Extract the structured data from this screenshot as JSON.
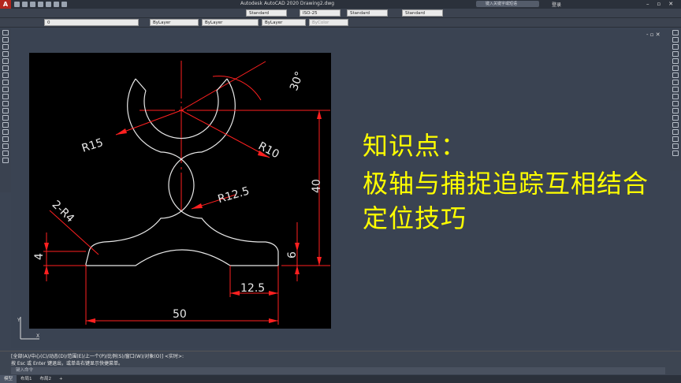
{
  "window": {
    "title": "Autodesk AutoCAD 2020    Drawing2.dwg",
    "search_placeholder": "键入关键字或短语",
    "user": "登录"
  },
  "ribbon": {
    "text_style": "Standard",
    "dim_style": "ISO-25",
    "table_style": "Standard",
    "mleader_style": "Standard",
    "layer": "0",
    "color": "ByLayer",
    "linetype": "ByLayer",
    "lineweight": "ByLayer",
    "plotstyle": "ByColor"
  },
  "drawing": {
    "angle_label": "30°",
    "r15": "R15",
    "r10": "R10",
    "r12_5": "R12.5",
    "two_r4": "2-R4",
    "dim_40": "40",
    "dim_4": "4",
    "dim_6": "6",
    "dim_12_5": "12.5",
    "dim_50": "50"
  },
  "overlay": {
    "line1": "知识点：",
    "line2": "极轴与捕捉追踪互相结合",
    "line3": "定位技巧",
    "color": "#ffff00"
  },
  "command": {
    "history1": "[全部(A)/中心(C)/动态(D)/范围(E)/上一个(P)/比例(S)/窗口(W)/对象(O)] <实时>:",
    "history2": "按 Esc 或 Enter 键退出，或单击右键显示快捷菜单。",
    "prompt": "键入命令"
  },
  "status": {
    "tabs": [
      "模型",
      "布局1",
      "布局2"
    ],
    "plus": "+"
  }
}
